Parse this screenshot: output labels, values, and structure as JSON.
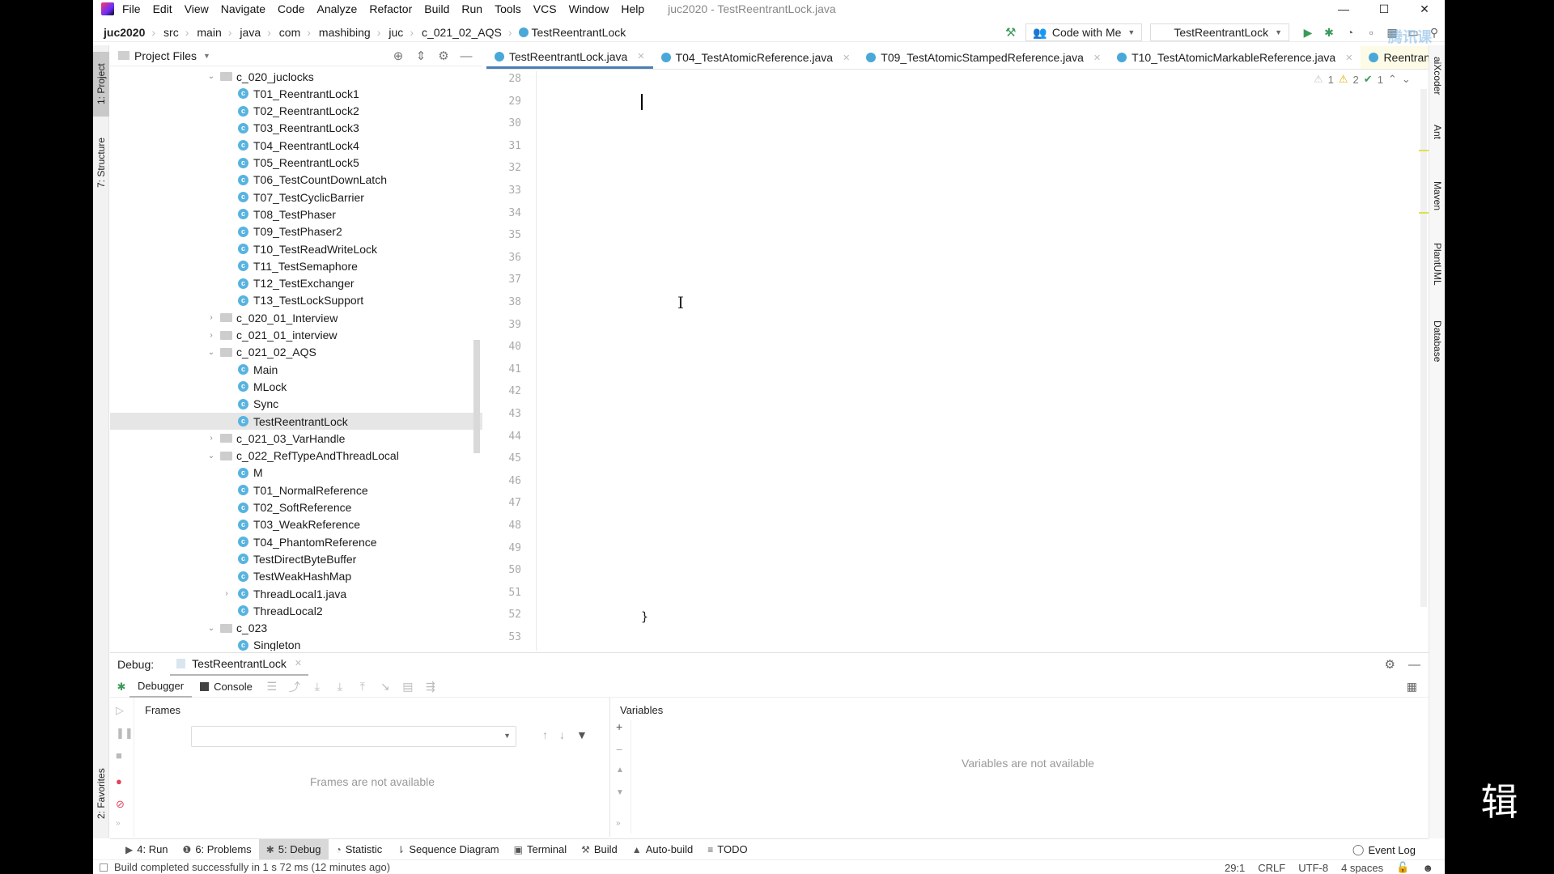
{
  "window": {
    "title": "juc2020 - TestReentrantLock.java",
    "controls": {
      "minimize": "—",
      "maximize": "☐",
      "close": "✕"
    }
  },
  "menu": [
    "File",
    "Edit",
    "View",
    "Navigate",
    "Code",
    "Analyze",
    "Refactor",
    "Build",
    "Run",
    "Tools",
    "VCS",
    "Window",
    "Help"
  ],
  "breadcrumb": [
    "juc2020",
    "src",
    "main",
    "java",
    "com",
    "mashibing",
    "juc",
    "c_021_02_AQS",
    "TestReentrantLock"
  ],
  "toolbar": {
    "code_with_me": "Code with Me",
    "run_config": "TestReentrantLock",
    "icons": [
      "hammer-icon",
      "run-icon",
      "debug-icon",
      "coverage-icon",
      "stop-icon",
      "project-structure-icon",
      "terminal-icon",
      "search-icon"
    ]
  },
  "left_strip": {
    "project": "1: Project",
    "structure": "7: Structure",
    "favorites": "2: Favorites"
  },
  "right_strip": [
    "aiXcoder",
    "Ant",
    "Maven",
    "PlantUML",
    "Database"
  ],
  "project": {
    "header": "Project Files",
    "tree": [
      {
        "label": "c_020_juclocks",
        "type": "folder",
        "depth": 0,
        "expanded": true
      },
      {
        "label": "T01_ReentrantLock1",
        "type": "class",
        "depth": 1
      },
      {
        "label": "T02_ReentrantLock2",
        "type": "class",
        "depth": 1
      },
      {
        "label": "T03_ReentrantLock3",
        "type": "class",
        "depth": 1
      },
      {
        "label": "T04_ReentrantLock4",
        "type": "class",
        "depth": 1
      },
      {
        "label": "T05_ReentrantLock5",
        "type": "class",
        "depth": 1
      },
      {
        "label": "T06_TestCountDownLatch",
        "type": "class",
        "depth": 1
      },
      {
        "label": "T07_TestCyclicBarrier",
        "type": "class",
        "depth": 1
      },
      {
        "label": "T08_TestPhaser",
        "type": "class",
        "depth": 1
      },
      {
        "label": "T09_TestPhaser2",
        "type": "class",
        "depth": 1
      },
      {
        "label": "T10_TestReadWriteLock",
        "type": "class",
        "depth": 1
      },
      {
        "label": "T11_TestSemaphore",
        "type": "class",
        "depth": 1
      },
      {
        "label": "T12_TestExchanger",
        "type": "class",
        "depth": 1
      },
      {
        "label": "T13_TestLockSupport",
        "type": "class",
        "depth": 1
      },
      {
        "label": "c_020_01_Interview",
        "type": "folder",
        "depth": 0,
        "expanded": false
      },
      {
        "label": "c_021_01_interview",
        "type": "folder",
        "depth": 0,
        "expanded": false
      },
      {
        "label": "c_021_02_AQS",
        "type": "folder",
        "depth": 0,
        "expanded": true
      },
      {
        "label": "Main",
        "type": "class",
        "depth": 1
      },
      {
        "label": "MLock",
        "type": "class",
        "depth": 1
      },
      {
        "label": "Sync",
        "type": "class",
        "depth": 1
      },
      {
        "label": "TestReentrantLock",
        "type": "class",
        "depth": 1,
        "selected": true
      },
      {
        "label": "c_021_03_VarHandle",
        "type": "folder",
        "depth": 0,
        "expanded": false
      },
      {
        "label": "c_022_RefTypeAndThreadLocal",
        "type": "folder",
        "depth": 0,
        "expanded": true
      },
      {
        "label": "M",
        "type": "class",
        "depth": 1
      },
      {
        "label": "T01_NormalReference",
        "type": "class",
        "depth": 1
      },
      {
        "label": "T02_SoftReference",
        "type": "class",
        "depth": 1
      },
      {
        "label": "T03_WeakReference",
        "type": "class",
        "depth": 1
      },
      {
        "label": "T04_PhantomReference",
        "type": "class",
        "depth": 1
      },
      {
        "label": "TestDirectByteBuffer",
        "type": "class",
        "depth": 1
      },
      {
        "label": "TestWeakHashMap",
        "type": "class",
        "depth": 1
      },
      {
        "label": "ThreadLocal1.java",
        "type": "class",
        "depth": 1,
        "expandable": true
      },
      {
        "label": "ThreadLocal2",
        "type": "class",
        "depth": 1
      },
      {
        "label": "c_023",
        "type": "folder",
        "depth": 0,
        "expanded": true
      },
      {
        "label": "Singleton",
        "type": "class",
        "depth": 1
      }
    ]
  },
  "editor": {
    "tabs": [
      {
        "label": "TestReentrantLock.java",
        "active": true
      },
      {
        "label": "T04_TestAtomicReference.java"
      },
      {
        "label": "T09_TestAtomicStampedReference.java"
      },
      {
        "label": "T10_TestAtomicMarkableReference.java"
      },
      {
        "label": "ReentrantLock.j",
        "highlighted": true
      }
    ],
    "line_numbers": [
      "28",
      "29",
      "30",
      "31",
      "32",
      "33",
      "34",
      "35",
      "36",
      "37",
      "38",
      "39",
      "40",
      "41",
      "42",
      "43",
      "44",
      "45",
      "46",
      "47",
      "48",
      "49",
      "50",
      "51",
      "52",
      "53"
    ],
    "closing_brace": "}",
    "inspections": {
      "weak_warnings": "1",
      "warnings": "2",
      "ok": "1"
    }
  },
  "debug": {
    "label": "Debug:",
    "session_tab": "TestReentrantLock",
    "subtabs": {
      "debugger": "Debugger",
      "console": "Console"
    },
    "frames_header": "Frames",
    "frames_empty": "Frames are not available",
    "variables_header": "Variables",
    "variables_empty": "Variables are not available"
  },
  "tool_windows": [
    {
      "label": "4: Run",
      "icon": "▶"
    },
    {
      "label": "6: Problems",
      "icon": "❶"
    },
    {
      "label": "5: Debug",
      "icon": "✱",
      "active": true
    },
    {
      "label": "Statistic",
      "icon": "◔"
    },
    {
      "label": "Sequence Diagram",
      "icon": "⇂"
    },
    {
      "label": "Terminal",
      "icon": "▣"
    },
    {
      "label": "Build",
      "icon": "⚒"
    },
    {
      "label": "Auto-build",
      "icon": "▲"
    },
    {
      "label": "TODO",
      "icon": "≡"
    }
  ],
  "event_log": "Event Log",
  "status": {
    "message": "Build completed successfully in 1 s 72 ms (12 minutes ago)",
    "position": "29:1",
    "line_sep": "CRLF",
    "encoding": "UTF-8",
    "indent": "4 spaces"
  },
  "overlay_char": "辑",
  "watermark": "腾讯课堂"
}
